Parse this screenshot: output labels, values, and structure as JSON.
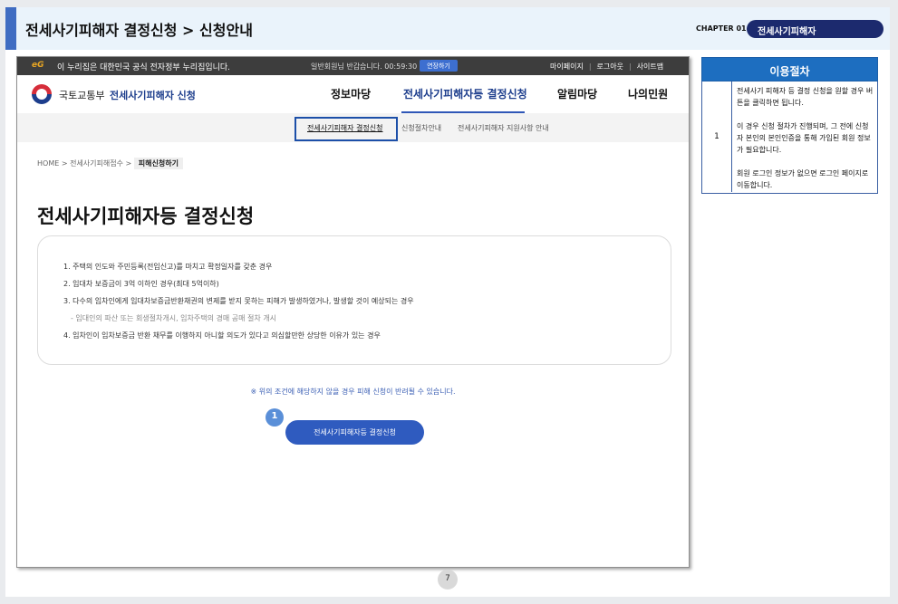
{
  "doc_header": {
    "title": "전세사기피해자 결정신청 > 신청안내",
    "chapter_label": "CHAPTER 01",
    "chapter_name": "전세사기피해자"
  },
  "screenshot": {
    "gov_bar": {
      "logo": "eG",
      "official_notice": "이 누리집은 대한민국 공식 전자정부 누리집입니다.",
      "session_text": "일반회원님 반갑습니다. 00:59:30",
      "extend_button": "연장하기",
      "util_links": [
        "마이페이지",
        "로그아웃",
        "사이트맵"
      ]
    },
    "header": {
      "ministry": "국토교통부",
      "service": "전세사기피해자 신청",
      "nav": [
        "정보마당",
        "전세사기피해자등 결정신청",
        "알림마당",
        "나의민원"
      ]
    },
    "sub_nav": [
      "전세사기피해자 결정신청",
      "신청절차안내",
      "전세사기피해자 지원사항 안내"
    ],
    "breadcrumb": {
      "home": "HOME",
      "sep": ">",
      "parent": "전세사기피해접수",
      "current": "피해신청하기"
    },
    "page_title": "전세사기피해자등 결정신청",
    "conditions": [
      "1. 주택의 인도와 주민등록(전입신고)를 마치고 확정일자를 갖춘 경우",
      "2. 임대차 보증금이 3억 이하인 경우(최대 5억이하)",
      "3. 다수의 임차인에게 임대차보증금반환채권의 변제를 받지 못하는 피해가 발생하였거나, 발생할 것이 예상되는 경우",
      "- 임대인의 파산 또는 회생절차개시, 임차주택의 경매 공매 절차 개시",
      "4. 임차인이 임차보증금 반환 채무를 이행하지 아니할 의도가 있다고 의심할만한 상당한 이유가 있는 경우"
    ],
    "notice": "※ 위의 조건에 해당하지 않을 경우 피해 신청이 반려될 수 있습니다.",
    "step_badge": "1",
    "apply_button": "전세사기피해자등 결정신청"
  },
  "procedure": {
    "heading": "이용절차",
    "row_number": "1",
    "paragraphs": [
      "전세사기 피해자 등 결정 신청을 원할 경우 버튼을 클릭하면 됩니다.",
      "이 경우 신청 절차가 진행되며, 그 전에 신청자 본인의 본인인증을 통해 가입된 회원 정보가 필요합니다.",
      "회원 로그인 정보가 없으면 로그인 페이지로 이동합니다."
    ]
  },
  "page_number": "7"
}
